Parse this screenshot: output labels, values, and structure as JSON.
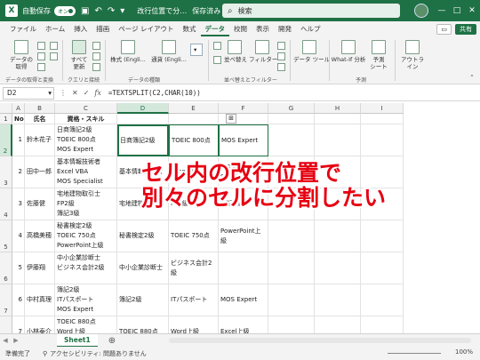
{
  "titlebar": {
    "autosave": "自動保存",
    "toggle": "オン",
    "filename": "改行位置で分…",
    "saved": "保存済み",
    "search": "検索"
  },
  "tabs": [
    "ファイル",
    "ホーム",
    "挿入",
    "描画",
    "ページ レイアウト",
    "数式",
    "データ",
    "校閲",
    "表示",
    "開発",
    "ヘルプ"
  ],
  "active_tab": "データ",
  "share": "共有",
  "ribbon": {
    "get_data": "データの\n取得",
    "refresh_all": "すべて\n更新",
    "stocks": "株式 (Engli...",
    "currency": "通貨 (Engli...",
    "sort": "並べ替え",
    "filter": "フィルター",
    "data_tools": "データ ツール",
    "whatif": "What-If 分析",
    "forecast": "予測\nシート",
    "outline": "アウトラ\nイン",
    "group_get": "データの取得と変換",
    "group_query": "クエリと接続",
    "group_types": "データの種類",
    "group_sort": "並べ替えとフィルター",
    "group_forecast": "予測"
  },
  "formula_bar": {
    "namebox": "D2",
    "fx": "fx",
    "formula": "=TEXTSPLIT(C2,CHAR(10))"
  },
  "columns": [
    "A",
    "B",
    "C",
    "D",
    "E",
    "F",
    "G",
    "H",
    "I"
  ],
  "header_row": {
    "no": "No",
    "name": "氏名",
    "skill": "資格・スキル"
  },
  "rows": [
    {
      "rownum": "2",
      "no": "1",
      "name": "鈴木花子",
      "skills": [
        "日商簿記2級",
        "TOEIC 800点",
        "MOS Expert"
      ],
      "d": "日商簿記2級",
      "e": "TOEIC 800点",
      "f": "MOS Expert"
    },
    {
      "rownum": "3",
      "no": "2",
      "name": "田中一郎",
      "skills": [
        "基本情報技術者",
        "Excel VBA",
        "MOS Specialist"
      ],
      "d": "基本情報技術者",
      "e": "Excel VBA",
      "f": "MOS Specialist"
    },
    {
      "rownum": "4",
      "no": "3",
      "name": "佐藤健",
      "skills": [
        "宅地建物取引士",
        "FP2級",
        "簿記3級"
      ],
      "d": "宅地建物取引士",
      "e": "FP2級",
      "f": "簿記3級"
    },
    {
      "rownum": "5",
      "no": "4",
      "name": "高橋美穂",
      "skills": [
        "秘書検定2級",
        "TOEIC 750点",
        "PowerPoint上級"
      ],
      "d": "秘書検定2級",
      "e": "TOEIC 750点",
      "f": "PowerPoint上級"
    },
    {
      "rownum": "6",
      "no": "5",
      "name": "伊藤翔",
      "skills": [
        "中小企業診断士",
        "ビジネス会計2級"
      ],
      "d": "中小企業診断士",
      "e": "ビジネス会計2級",
      "f": ""
    },
    {
      "rownum": "7",
      "no": "6",
      "name": "中村真理",
      "skills": [
        "簿記2級",
        "ITパスポート",
        "MOS Expert"
      ],
      "d": "簿記2級",
      "e": "ITパスポート",
      "f": "MOS Expert"
    },
    {
      "rownum": "8",
      "no": "7",
      "name": "小林泰介",
      "skills": [
        "TOEIC 880点",
        "Word上級"
      ],
      "d": "TOEIC 880点",
      "e": "Word上級",
      "f": "Excel上級"
    }
  ],
  "overlay": {
    "line1": "セル内の改行位置で",
    "line2": "別々のセルに分割したい"
  },
  "sheet_tab": "Sheet1",
  "status": {
    "ready": "準備完了",
    "accessibility": "アクセシビリティ: 問題ありません",
    "zoom": "100%"
  }
}
